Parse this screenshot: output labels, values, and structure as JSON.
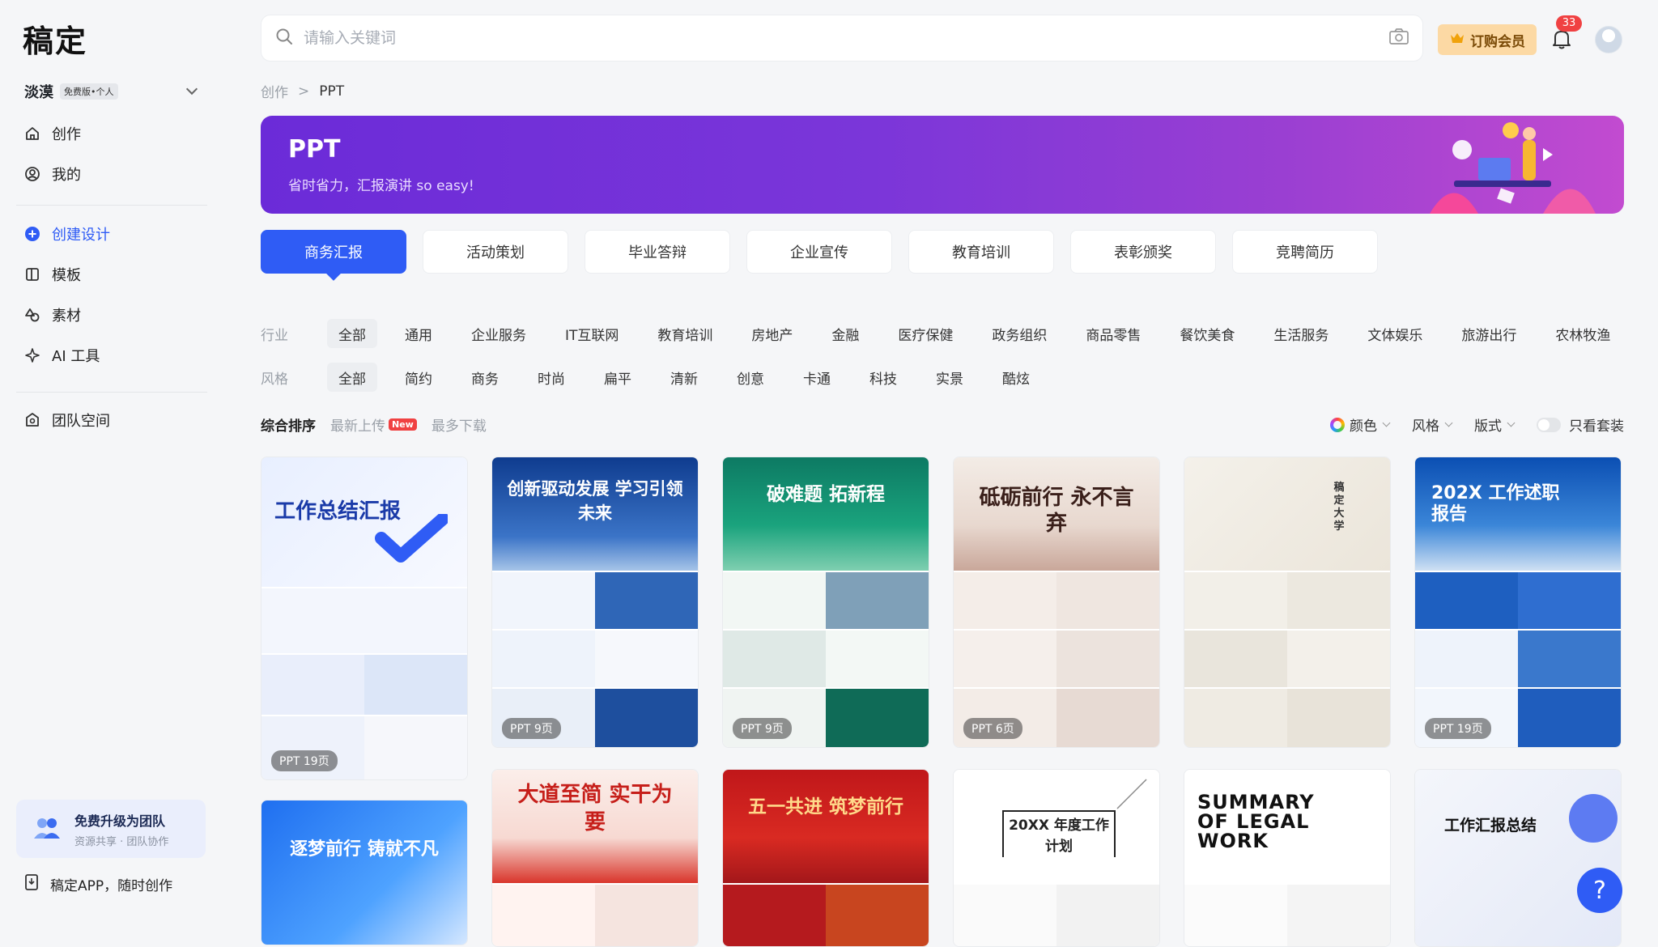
{
  "app": {
    "logo": "稿定"
  },
  "account": {
    "name": "淡漠",
    "plan_badge": "免费版•个人"
  },
  "sidebar": {
    "items": [
      {
        "label": "创作",
        "icon": "home-icon"
      },
      {
        "label": "我的",
        "icon": "user-icon"
      },
      {
        "label": "创建设计",
        "icon": "plus-circle-icon"
      },
      {
        "label": "模板",
        "icon": "template-icon"
      },
      {
        "label": "素材",
        "icon": "shapes-icon"
      },
      {
        "label": "AI 工具",
        "icon": "sparkle-icon"
      },
      {
        "label": "团队空间",
        "icon": "team-icon"
      }
    ],
    "promo": {
      "title": "免费升级为团队",
      "subtitle": "资源共享 · 团队协作"
    },
    "app_link": "稿定APP，随时创作"
  },
  "header": {
    "search_placeholder": "请输入关键词",
    "vip_label": "订购会员",
    "notification_count": "33"
  },
  "breadcrumb": {
    "parent": "创作",
    "sep": ">",
    "current": "PPT"
  },
  "banner": {
    "title": "PPT",
    "subtitle": "省时省力，汇报演讲 so easy!"
  },
  "tabs": [
    "商务汇报",
    "活动策划",
    "毕业答辩",
    "企业宣传",
    "教育培训",
    "表彰颁奖",
    "竞聘简历"
  ],
  "filters": {
    "industry": {
      "label": "行业",
      "options": [
        "全部",
        "通用",
        "企业服务",
        "IT互联网",
        "教育培训",
        "房地产",
        "金融",
        "医疗保健",
        "政务组织",
        "商品零售",
        "餐饮美食",
        "生活服务",
        "文体娱乐",
        "旅游出行",
        "农林牧渔"
      ]
    },
    "style": {
      "label": "风格",
      "options": [
        "全部",
        "简约",
        "商务",
        "时尚",
        "扁平",
        "清新",
        "创意",
        "卡通",
        "科技",
        "实景",
        "酷炫"
      ]
    }
  },
  "sort": {
    "options": [
      "综合排序",
      "最新上传",
      "最多下载"
    ],
    "new_badge": "New"
  },
  "right_filters": {
    "color": "颜色",
    "style": "风格",
    "layout": "版式",
    "toggle_label": "只看套装"
  },
  "cards": [
    {
      "title": "工作总结汇报",
      "pages": "PPT 19页"
    },
    {
      "title": "创新驱动发展 学习引领未来",
      "pages": "PPT 9页"
    },
    {
      "title": "破难题 拓新程",
      "pages": "PPT 9页"
    },
    {
      "title": "砥砺前行 永不言弃",
      "pages": "PPT 6页"
    },
    {
      "title": "稿定大学",
      "pages": ""
    },
    {
      "title": "202X 工作述职报告",
      "pages": "PPT 19页"
    },
    {
      "title": "逐梦前行 铸就不凡",
      "pages": ""
    },
    {
      "title": "大道至简 实干为要",
      "pages": ""
    },
    {
      "title": "五一共进 筑梦前行",
      "pages": ""
    },
    {
      "title": "20XX 年度工作计划",
      "pages": ""
    },
    {
      "title": "SUMMARY OF LEGAL WORK",
      "pages": ""
    },
    {
      "title": "工作汇报总结",
      "pages": ""
    }
  ],
  "help": "?"
}
